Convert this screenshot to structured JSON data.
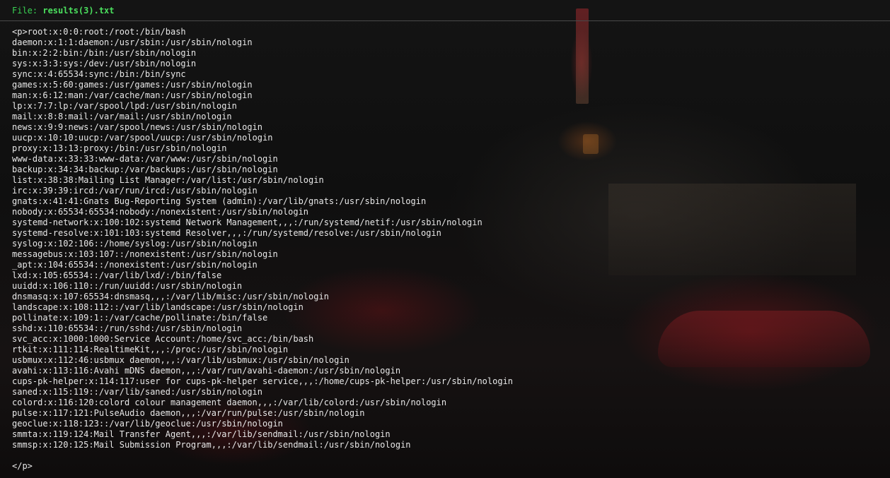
{
  "header": {
    "label": "File: ",
    "filename": "results(3).txt"
  },
  "colors": {
    "header_text": "#39d353",
    "body_text": "#e8e8e8",
    "background": "#0d0d0d"
  },
  "content": {
    "open_tag": "<p>",
    "lines": [
      "root:x:0:0:root:/root:/bin/bash",
      "daemon:x:1:1:daemon:/usr/sbin:/usr/sbin/nologin",
      "bin:x:2:2:bin:/bin:/usr/sbin/nologin",
      "sys:x:3:3:sys:/dev:/usr/sbin/nologin",
      "sync:x:4:65534:sync:/bin:/bin/sync",
      "games:x:5:60:games:/usr/games:/usr/sbin/nologin",
      "man:x:6:12:man:/var/cache/man:/usr/sbin/nologin",
      "lp:x:7:7:lp:/var/spool/lpd:/usr/sbin/nologin",
      "mail:x:8:8:mail:/var/mail:/usr/sbin/nologin",
      "news:x:9:9:news:/var/spool/news:/usr/sbin/nologin",
      "uucp:x:10:10:uucp:/var/spool/uucp:/usr/sbin/nologin",
      "proxy:x:13:13:proxy:/bin:/usr/sbin/nologin",
      "www-data:x:33:33:www-data:/var/www:/usr/sbin/nologin",
      "backup:x:34:34:backup:/var/backups:/usr/sbin/nologin",
      "list:x:38:38:Mailing List Manager:/var/list:/usr/sbin/nologin",
      "irc:x:39:39:ircd:/var/run/ircd:/usr/sbin/nologin",
      "gnats:x:41:41:Gnats Bug-Reporting System (admin):/var/lib/gnats:/usr/sbin/nologin",
      "nobody:x:65534:65534:nobody:/nonexistent:/usr/sbin/nologin",
      "systemd-network:x:100:102:systemd Network Management,,,:/run/systemd/netif:/usr/sbin/nologin",
      "systemd-resolve:x:101:103:systemd Resolver,,,:/run/systemd/resolve:/usr/sbin/nologin",
      "syslog:x:102:106::/home/syslog:/usr/sbin/nologin",
      "messagebus:x:103:107::/nonexistent:/usr/sbin/nologin",
      "_apt:x:104:65534::/nonexistent:/usr/sbin/nologin",
      "lxd:x:105:65534::/var/lib/lxd/:/bin/false",
      "uuidd:x:106:110::/run/uuidd:/usr/sbin/nologin",
      "dnsmasq:x:107:65534:dnsmasq,,,:/var/lib/misc:/usr/sbin/nologin",
      "landscape:x:108:112::/var/lib/landscape:/usr/sbin/nologin",
      "pollinate:x:109:1::/var/cache/pollinate:/bin/false",
      "sshd:x:110:65534::/run/sshd:/usr/sbin/nologin",
      "svc_acc:x:1000:1000:Service Account:/home/svc_acc:/bin/bash",
      "rtkit:x:111:114:RealtimeKit,,,:/proc:/usr/sbin/nologin",
      "usbmux:x:112:46:usbmux daemon,,,:/var/lib/usbmux:/usr/sbin/nologin",
      "avahi:x:113:116:Avahi mDNS daemon,,,:/var/run/avahi-daemon:/usr/sbin/nologin",
      "cups-pk-helper:x:114:117:user for cups-pk-helper service,,,:/home/cups-pk-helper:/usr/sbin/nologin",
      "saned:x:115:119::/var/lib/saned:/usr/sbin/nologin",
      "colord:x:116:120:colord colour management daemon,,,:/var/lib/colord:/usr/sbin/nologin",
      "pulse:x:117:121:PulseAudio daemon,,,:/var/run/pulse:/usr/sbin/nologin",
      "geoclue:x:118:123::/var/lib/geoclue:/usr/sbin/nologin",
      "smmta:x:119:124:Mail Transfer Agent,,,:/var/lib/sendmail:/usr/sbin/nologin",
      "smmsp:x:120:125:Mail Submission Program,,,:/var/lib/sendmail:/usr/sbin/nologin"
    ],
    "close_tag": "</p>"
  }
}
